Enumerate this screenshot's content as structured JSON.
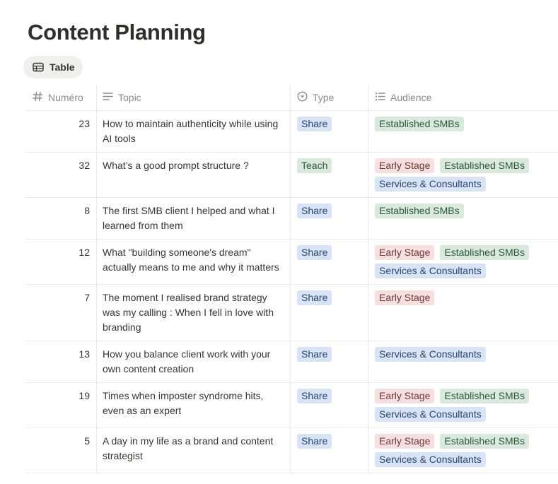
{
  "page": {
    "title": "Content Planning"
  },
  "view_tab": {
    "label": "Table",
    "icon": "table-icon"
  },
  "columns": [
    {
      "label": "Numéro",
      "icon": "hash-icon"
    },
    {
      "label": "Topic",
      "icon": "text-lines-icon"
    },
    {
      "label": "Type",
      "icon": "select-icon"
    },
    {
      "label": "Audience",
      "icon": "multi-select-icon"
    }
  ],
  "colors": {
    "blue": "#d9e3f6",
    "green": "#dbe8dd",
    "red": "#f6dfe1"
  },
  "rows": [
    {
      "num": "23",
      "topic": "How to maintain authenticity while using AI tools",
      "type": "Share",
      "audience": [
        "Established SMBs"
      ]
    },
    {
      "num": "32",
      "topic": "What’s a good prompt structure ?",
      "type": "Teach",
      "audience": [
        "Early Stage",
        "Established SMBs",
        "Services & Consultants"
      ]
    },
    {
      "num": "8",
      "topic": "The first SMB client I helped and what I learned from them",
      "type": "Share",
      "audience": [
        "Established SMBs"
      ]
    },
    {
      "num": "12",
      "topic": "What \"building someone's dream\" actually means to me and why it matters",
      "type": "Share",
      "audience": [
        "Early Stage",
        "Established SMBs",
        "Services & Consultants"
      ]
    },
    {
      "num": "7",
      "topic": "The moment I realised brand strategy was my calling : When I fell in love with branding",
      "type": "Share",
      "audience": [
        "Early Stage"
      ]
    },
    {
      "num": "13",
      "topic": "How you balance client work with your own content creation",
      "type": "Share",
      "audience": [
        "Services & Consultants"
      ]
    },
    {
      "num": "19",
      "topic": "Times when imposter syndrome hits, even as an expert",
      "type": "Share",
      "audience": [
        "Early Stage",
        "Established SMBs",
        "Services & Consultants"
      ]
    },
    {
      "num": "5",
      "topic": "A day in my life as a brand and content strategist",
      "type": "Share",
      "audience": [
        "Early Stage",
        "Established SMBs",
        "Services & Consultants"
      ]
    }
  ]
}
